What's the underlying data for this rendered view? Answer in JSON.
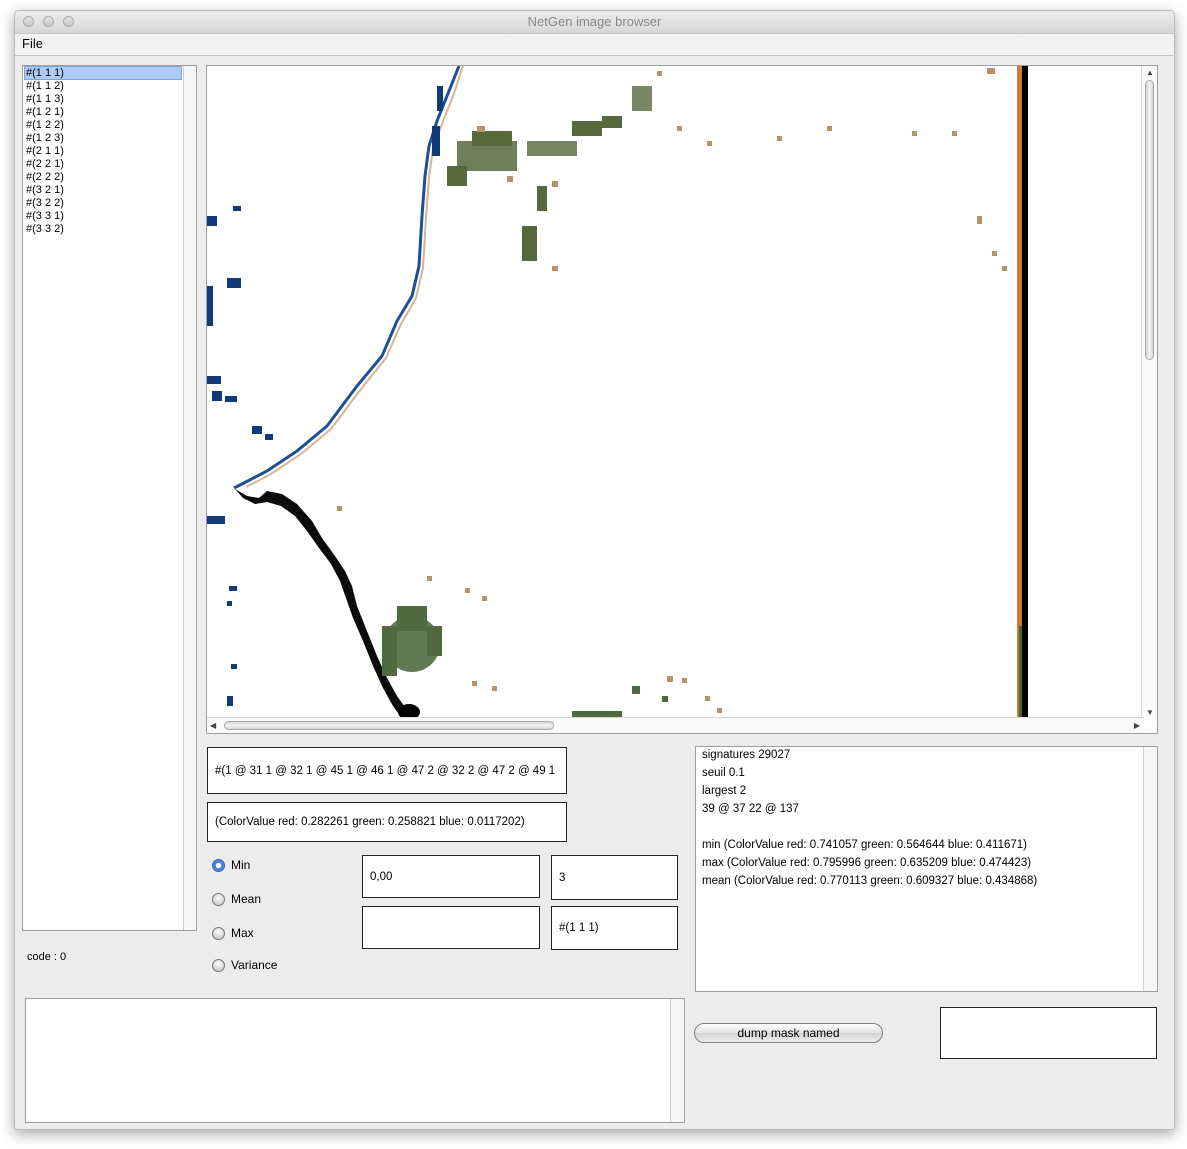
{
  "window": {
    "title": "NetGen image browser"
  },
  "menu": {
    "file": "File"
  },
  "image_list": [
    "#(1 1 1)",
    "#(1 1 2)",
    "#(1 1 3)",
    "#(1 2 1)",
    "#(1 2 2)",
    "#(1 2 3)",
    "#(2 1 1)",
    "#(2 2 1)",
    "#(2 2 2)",
    "#(3 2 1)",
    "#(3 2 2)",
    "#(3 3 1)",
    "#(3 3 2)"
  ],
  "selected_image": "#(1 1 1)",
  "code_label": "code : 0",
  "signature_field": "#(1 @ 31 1 @ 32 1 @ 45 1 @ 46 1 @ 47 2 @ 32 2 @ 47 2 @ 49 1",
  "color_value_field": "(ColorValue red: 0.282261 green: 0.258821 blue: 0.0117202)",
  "stat_options": [
    "Min",
    "Mean",
    "Max",
    "Variance"
  ],
  "selected_stat": "Min",
  "threshold_field": "0,00",
  "count_field": "3",
  "empty_field": "",
  "current_image_field": "#(1 1 1)",
  "info_lines": [
    "signatures  29027",
    "seuil  0.1",
    "largest  2",
    "39 @ 37 22 @ 137",
    "",
    "min (ColorValue red: 0.741057 green: 0.564644 blue: 0.411671)",
    "max (ColorValue red: 0.795996 green: 0.635209 blue: 0.474423)",
    "mean (ColorValue red: 0.770113 green: 0.609327 blue: 0.434868)"
  ],
  "dump_button": "dump mask named",
  "mask_name_field": "",
  "icons": {
    "scroll_up": "▲",
    "scroll_down": "▼",
    "scroll_left": "◀",
    "scroll_right": "▶"
  },
  "colors": {
    "selection": "#aecbf5",
    "radio_selected": "#2f6fd0",
    "water": "#123a78",
    "vegetation": "#4f6a3f"
  }
}
